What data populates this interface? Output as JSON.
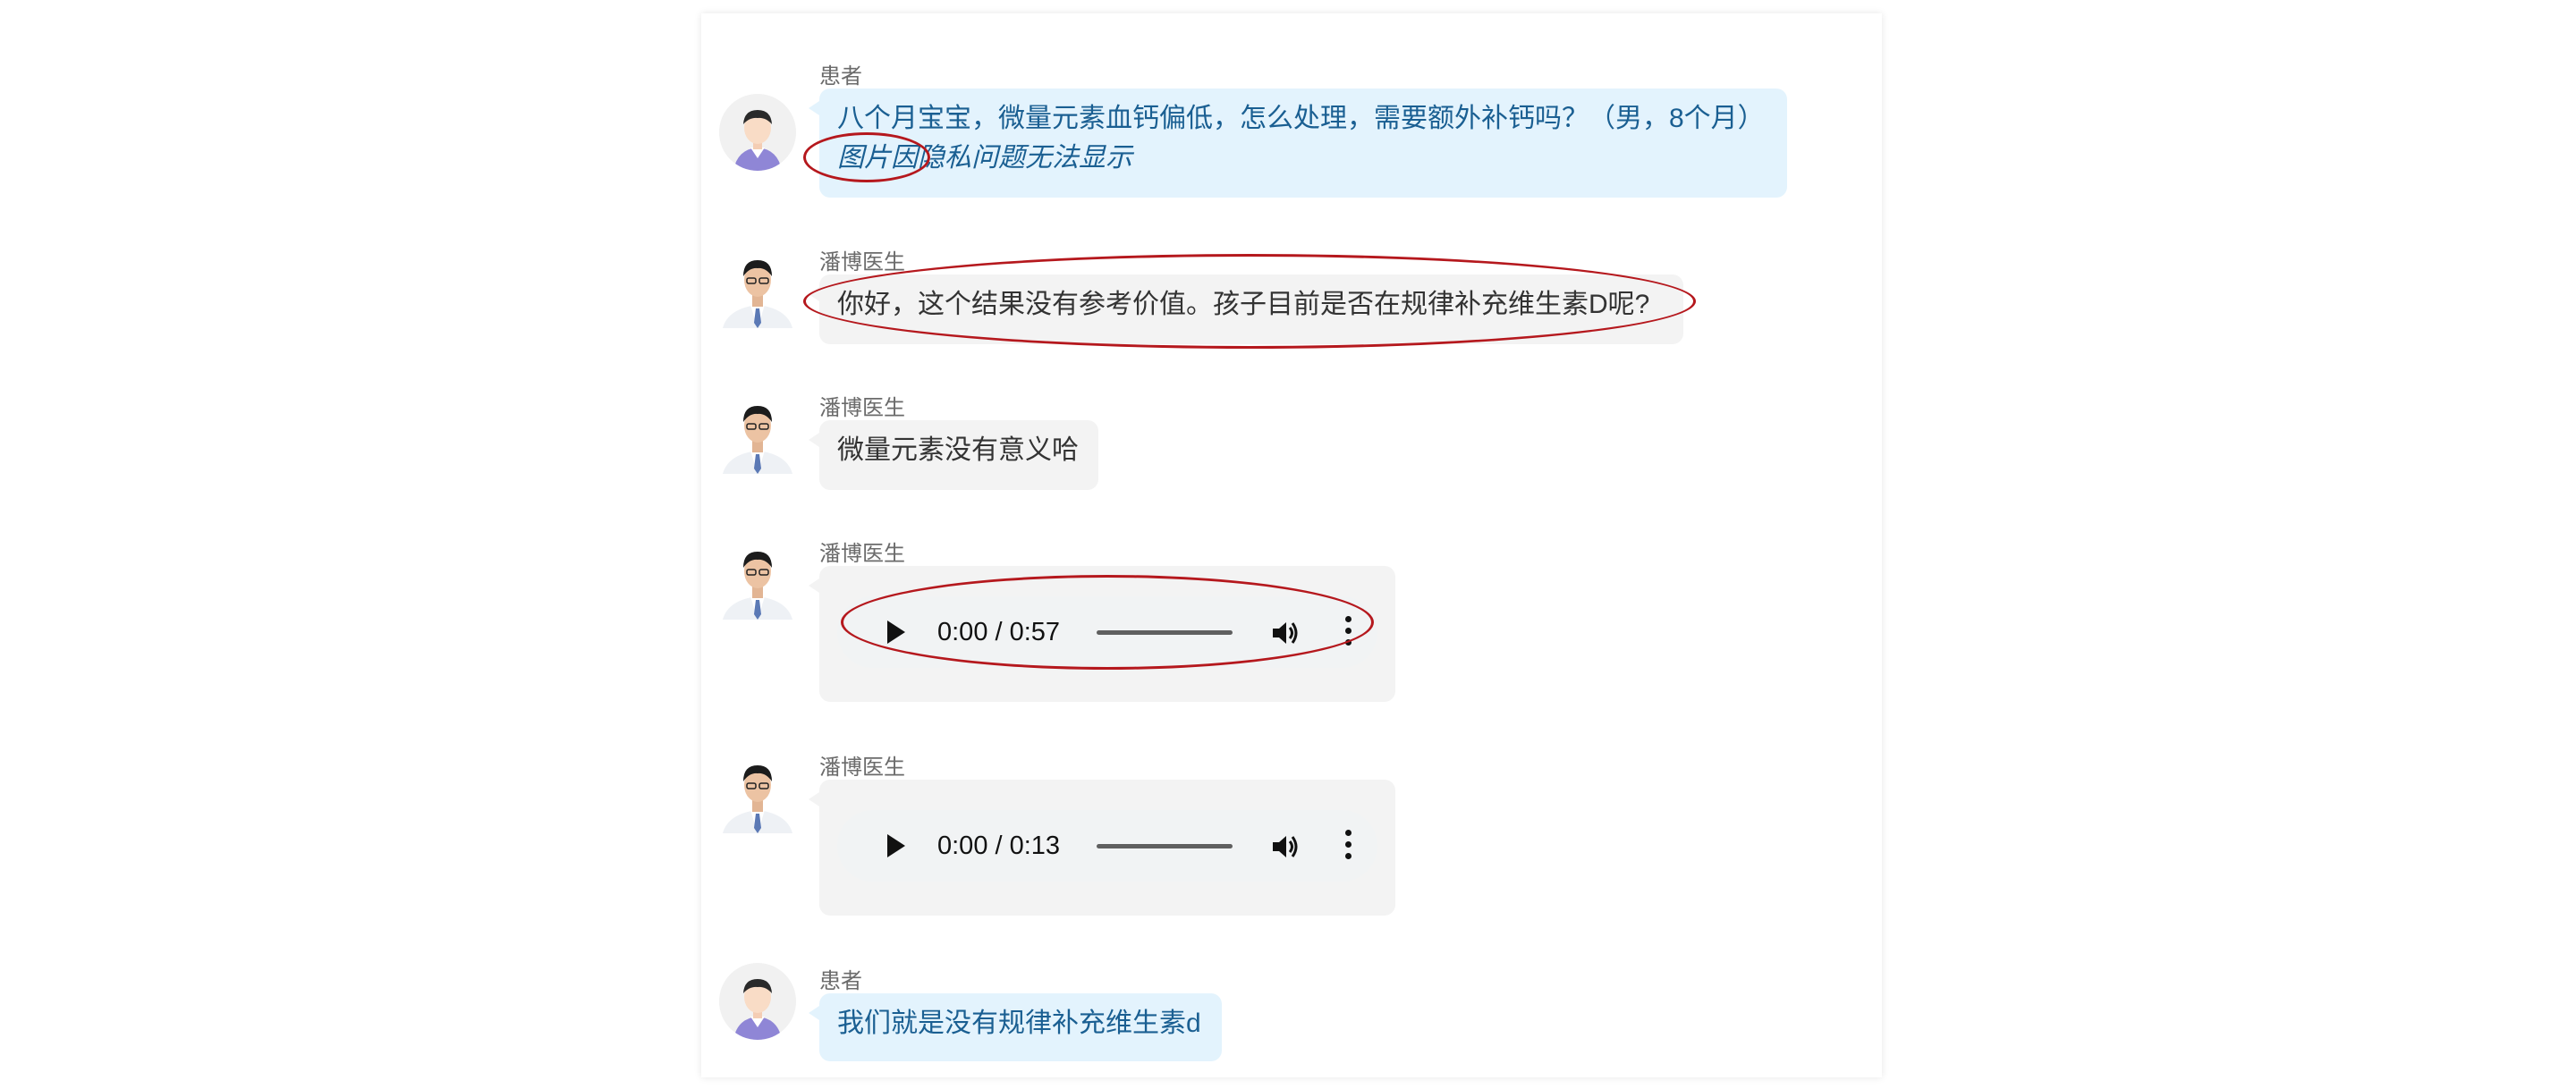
{
  "messages": [
    {
      "sender": "患者",
      "role": "patient",
      "text": "八个月宝宝，微量元素血钙偏低，怎么处理，需要额外补钙吗？（男，8个月）",
      "note": "图片因隐私问题无法显示"
    },
    {
      "sender": "潘博医生",
      "role": "doctor",
      "text": "你好，这个结果没有参考价值。孩子目前是否在规律补充维生素D呢?"
    },
    {
      "sender": "潘博医生",
      "role": "doctor",
      "text": "微量元素没有意义哈"
    },
    {
      "sender": "潘博医生",
      "role": "doctor",
      "audio": {
        "time": "0:00 / 0:57",
        "progress": 0
      }
    },
    {
      "sender": "潘博医生",
      "role": "doctor",
      "audio": {
        "time": "0:00 / 0:13",
        "progress": 0
      }
    },
    {
      "sender": "患者",
      "role": "patient",
      "text": "我们就是没有规律补充维生素d"
    }
  ],
  "colors": {
    "annotation": "#b5181d",
    "patient_bubble": "#e3f3fd",
    "doctor_bubble": "#f3f3f3"
  }
}
